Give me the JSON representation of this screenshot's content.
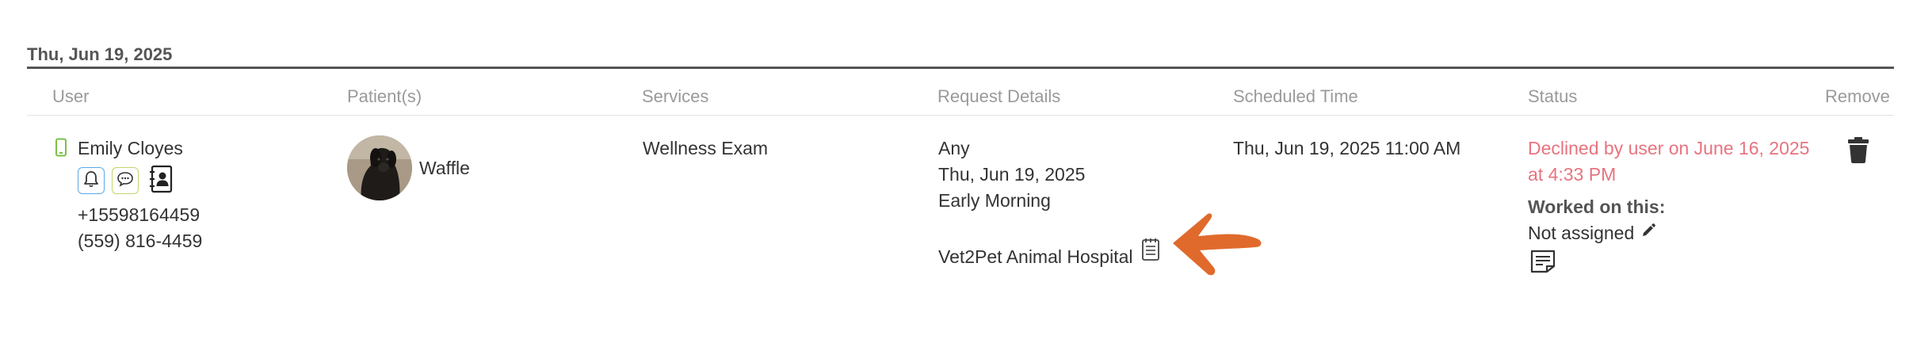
{
  "date_group": {
    "label": "Thu, Jun 19, 2025"
  },
  "columns": [
    "User",
    "Patient(s)",
    "Services",
    "Request Details",
    "Scheduled Time",
    "Status",
    "Remove"
  ],
  "row": {
    "user": {
      "name": "Emily Cloyes",
      "phone_1": "+15598164459",
      "phone_2": "(559) 816-4459",
      "icons": [
        "mobile-phone-icon",
        "bell-icon",
        "chat-bubble-icon",
        "contact-card-icon"
      ]
    },
    "patient": {
      "name": "Waffle"
    },
    "service": "Wellness Exam",
    "request_details": {
      "line_1": "Any",
      "line_2": "Thu, Jun 19, 2025",
      "line_3": "Early Morning",
      "hospital": "Vet2Pet Animal Hospital"
    },
    "scheduled_time": "Thu, Jun 19, 2025 11:00 AM",
    "status": {
      "line_1": "Declined by user on June 16, 2025",
      "line_2": "at 4:33 PM",
      "worked_on_label": "Worked on this:",
      "assignee": "Not assigned"
    }
  },
  "colors": {
    "declined": "#e8737f",
    "phone_icon": "#7bbf4a",
    "bell_border": "#5aa9e6",
    "chat_border": "#c9d36b",
    "annotation_arrow": "#e06a2c",
    "header_rule": "#555555"
  }
}
